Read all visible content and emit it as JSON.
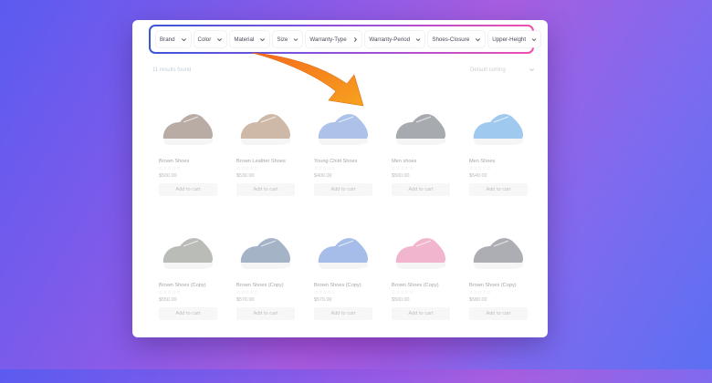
{
  "filters": [
    {
      "label": "Brand",
      "chevron": "down"
    },
    {
      "label": "Color",
      "chevron": "down"
    },
    {
      "label": "Material",
      "chevron": "down"
    },
    {
      "label": "Size",
      "chevron": "down"
    },
    {
      "label": "Warranty-Type",
      "chevron": "right"
    },
    {
      "label": "Warranty-Period",
      "chevron": "down"
    },
    {
      "label": "Shoes-Closure",
      "chevron": "down"
    },
    {
      "label": "Upper-Height",
      "chevron": "down"
    }
  ],
  "results_text": "11 results found",
  "sorting_label": "Default sorting",
  "products": [
    {
      "name": "Brown Shoes",
      "stars": "☆☆☆☆☆",
      "price": "$500.00",
      "button": "Add to cart",
      "image": "brown-shoe",
      "color": "#5a3a28"
    },
    {
      "name": "Brown Leather Shoes",
      "stars": "☆☆☆☆☆",
      "price": "$530.00",
      "button": "Add to cart",
      "image": "brown-leather-shoe",
      "color": "#8a5a33"
    },
    {
      "name": "Young Child Shoes",
      "stars": "☆☆☆☆☆",
      "price": "$400.00",
      "button": "Add to cart",
      "image": "child-shoe",
      "color": "#3d6fc8"
    },
    {
      "name": "Men shoes",
      "stars": "☆☆☆☆☆",
      "price": "$500.00",
      "button": "Add to cart",
      "image": "men-sneaker",
      "color": "#2f3540"
    },
    {
      "name": "Men Shoes",
      "stars": "☆☆☆☆☆",
      "price": "$540.00",
      "button": "Add to cart",
      "image": "blue-sneaker",
      "color": "#1e7fd8"
    },
    {
      "name": "Brown Shoes (Copy)",
      "stars": "☆☆☆☆☆",
      "price": "$550.00",
      "button": "Add to cart",
      "image": "grey-sneaker",
      "color": "#5a5f55"
    },
    {
      "name": "Brown Shoes (Copy)",
      "stars": "☆☆☆☆☆",
      "price": "$570.00",
      "button": "Add to cart",
      "image": "blue-hightop",
      "color": "#2a4a7a"
    },
    {
      "name": "Brown Shoes (Copy)",
      "stars": "☆☆☆☆☆",
      "price": "$570.00",
      "button": "Add to cart",
      "image": "blue-runner",
      "color": "#2a63c8"
    },
    {
      "name": "Brown Shoes (Copy)",
      "stars": "☆☆☆☆☆",
      "price": "$500.00",
      "button": "Add to cart",
      "image": "pink-sneaker",
      "color": "#e0508a"
    },
    {
      "name": "Brown Shoes (Copy)",
      "stars": "☆☆☆☆☆",
      "price": "$580.00",
      "button": "Add to cart",
      "image": "dark-loafer",
      "color": "#3a3f4a"
    }
  ],
  "colors": {
    "accent_gradient_start": "#3a57d6",
    "accent_gradient_end": "#ee4fb0",
    "arrow": "#f28a1a"
  }
}
